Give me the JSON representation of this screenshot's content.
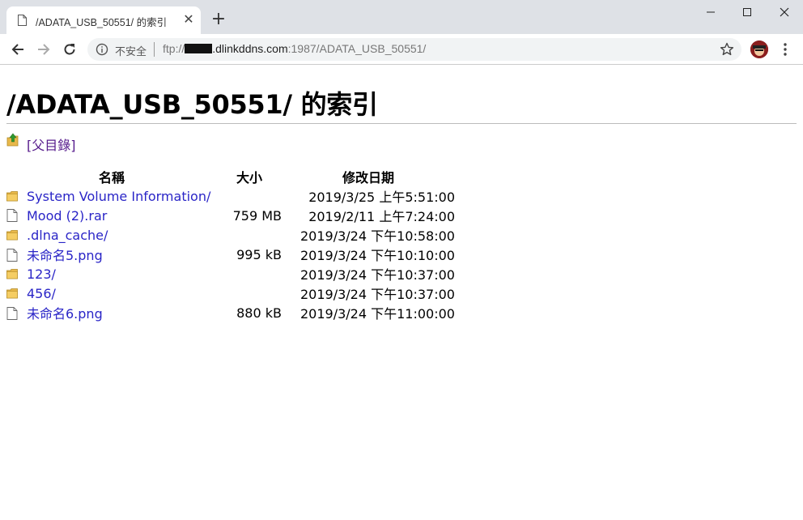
{
  "browser": {
    "tab_title": "/ADATA_USB_50551/ 的索引",
    "close_glyph": "✕",
    "new_tab_glyph": "+",
    "insecure_label": "不安全",
    "url_prefix": "ftp://",
    "url_host": ".dlinkddns.com",
    "url_rest": ":1987/ADATA_USB_50551/"
  },
  "page": {
    "heading": "/ADATA_USB_50551/ 的索引",
    "parent_link": "[父目錄]",
    "columns": {
      "name": "名稱",
      "size": "大小",
      "date": "修改日期"
    },
    "entries": [
      {
        "name": "System Volume Information/",
        "size": "",
        "date": "2019/3/25 上午5:51:00",
        "icon": "folder-icon"
      },
      {
        "name": "Mood (2).rar",
        "size": "759 MB",
        "date": "2019/2/11 上午7:24:00",
        "icon": "file-icon"
      },
      {
        "name": ".dlna_cache/",
        "size": "",
        "date": "2019/3/24 下午10:58:00",
        "icon": "folder-icon"
      },
      {
        "name": "未命名5.png",
        "size": "995 kB",
        "date": "2019/3/24 下午10:10:00",
        "icon": "file-icon"
      },
      {
        "name": "123/",
        "size": "",
        "date": "2019/3/24 下午10:37:00",
        "icon": "folder-icon"
      },
      {
        "name": "456/",
        "size": "",
        "date": "2019/3/24 下午10:37:00",
        "icon": "folder-icon"
      },
      {
        "name": "未命名6.png",
        "size": "880 kB",
        "date": "2019/3/24 下午11:00:00",
        "icon": "file-icon"
      }
    ]
  },
  "colors": {
    "link": "#2a25c7",
    "visited_link": "#551a8b",
    "folder": "#e8b84a"
  }
}
